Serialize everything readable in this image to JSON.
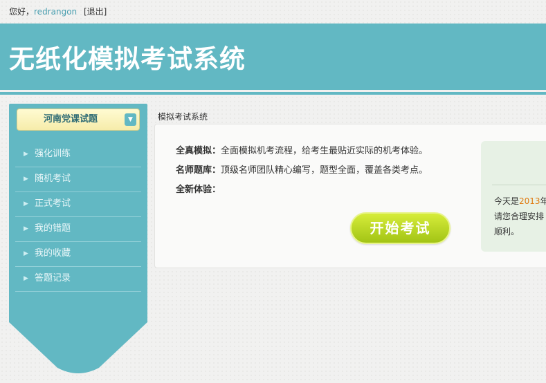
{
  "topbar": {
    "greeting": "您好，",
    "username": "redrangon",
    "logout": "[退出]"
  },
  "header": {
    "title": "无纸化模拟考试系统"
  },
  "sidebar": {
    "subject": "河南党课试题",
    "items": [
      {
        "label": "强化训练"
      },
      {
        "label": "随机考试"
      },
      {
        "label": "正式考试"
      },
      {
        "label": "我的错题"
      },
      {
        "label": "我的收藏"
      },
      {
        "label": "答题记录"
      }
    ]
  },
  "main": {
    "breadcrumb": "模拟考试系统",
    "features": [
      {
        "title": "全真模拟：",
        "desc": "全面模拟机考流程，给考生最贴近实际的机考体验。"
      },
      {
        "title": "名师题库：",
        "desc": "顶级名师团队精心编写，题型全面，覆盖各类考点。"
      },
      {
        "title": "全新体验：",
        "desc": ""
      }
    ],
    "start_button": "开始考试",
    "notice": {
      "line1_prefix": "今天是",
      "year": "2013",
      "line1_suffix": "年",
      "line2": "请您合理安排",
      "line3": "顺利。"
    }
  },
  "colors": {
    "primary": "#62b8c3",
    "accent_green": "#a2c415",
    "highlight_orange": "#e07a10"
  }
}
